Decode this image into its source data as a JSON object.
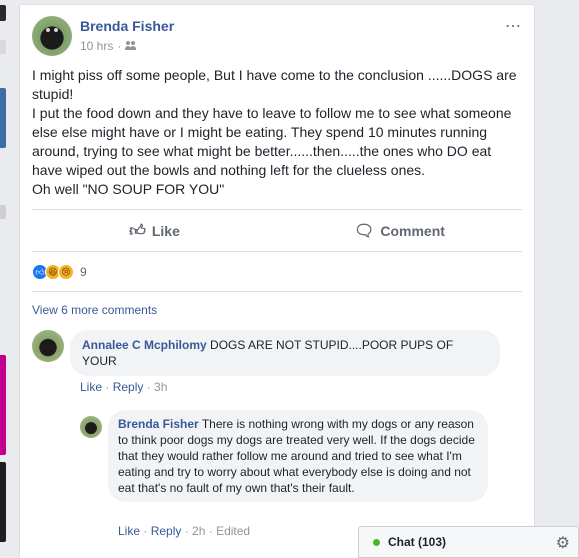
{
  "post": {
    "author": "Brenda Fisher",
    "time": "10 hrs",
    "separator": "·",
    "more_icon": "⋯",
    "body": [
      "I might piss off some people, But I have come to the conclusion ......DOGS are stupid!",
      "I put the food down and they have to leave to follow me to see what someone else else might have or I might be eating. They spend 10 minutes running around, trying to see what might be better......then.....the ones who DO eat have wiped out the bowls and nothing left for the clueless ones.",
      "Oh well \"NO SOUP FOR YOU\""
    ]
  },
  "actions": {
    "like_label": "Like",
    "comment_label": "Comment"
  },
  "reactions": {
    "count": "9",
    "types": [
      "like",
      "haha",
      "sad"
    ]
  },
  "comments": {
    "view_more": "View 6 more comments",
    "items": [
      {
        "author": "Annalee C Mcphilomy",
        "text": "DOGS ARE NOT STUPID....POOR PUPS OF YOUR",
        "like_label": "Like",
        "reply_label": "Reply",
        "time": "3h"
      },
      {
        "author": "Brenda Fisher",
        "text": "There is nothing wrong with my dogs or any reason to think poor dogs my dogs are treated very well. If the dogs decide that they would rather follow me around and tried to see what I'm eating and try to worry about what everybody else is doing and not eat that's no fault of my own that's their fault.",
        "like_label": "Like",
        "reply_label": "Reply",
        "time": "2h",
        "edited": "Edited"
      }
    ]
  },
  "chat": {
    "label": "Chat (103)",
    "status_color": "#42b72a"
  },
  "colors": {
    "link": "#385898",
    "secondary_text": "#90949c",
    "background": "#e9ebee"
  }
}
